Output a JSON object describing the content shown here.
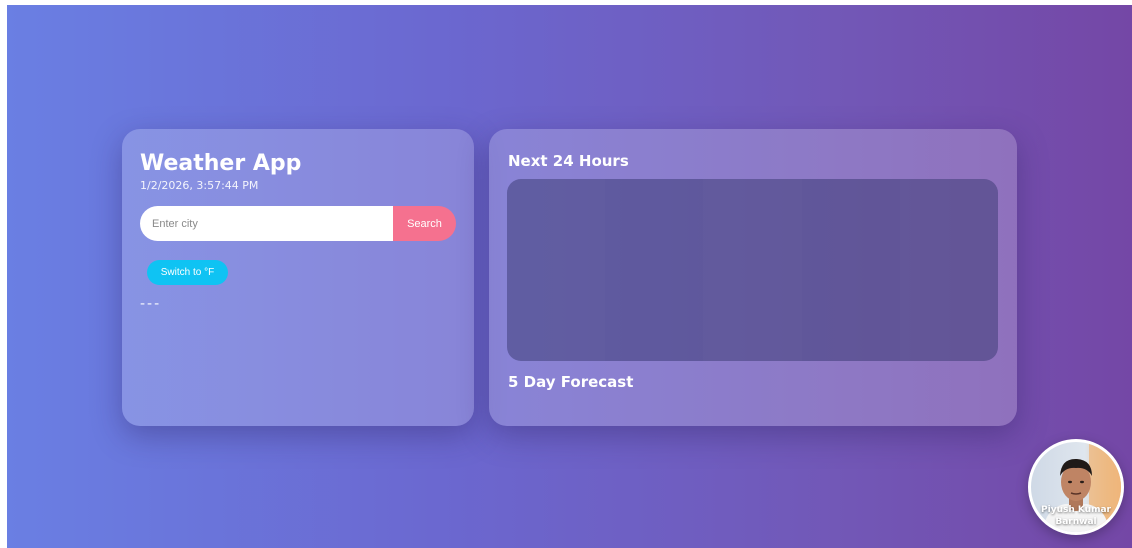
{
  "app": {
    "title": "Weather App",
    "datetime": "1/2/2026, 3:57:44 PM"
  },
  "search": {
    "placeholder": "Enter city",
    "value": "",
    "button_label": "Search"
  },
  "unit_toggle": {
    "label": "Switch to °F"
  },
  "current": {
    "temperature_placeholder": "---"
  },
  "forecast": {
    "hourly_title": "Next 24 Hours",
    "daily_title": "5 Day Forecast"
  },
  "profile": {
    "name": "Piyush Kumar Barnwal"
  },
  "colors": {
    "search_button": "#f5718f",
    "unit_button": "#0fc3f3",
    "background_start": "#6a7fe3",
    "background_end": "#7447a6"
  }
}
